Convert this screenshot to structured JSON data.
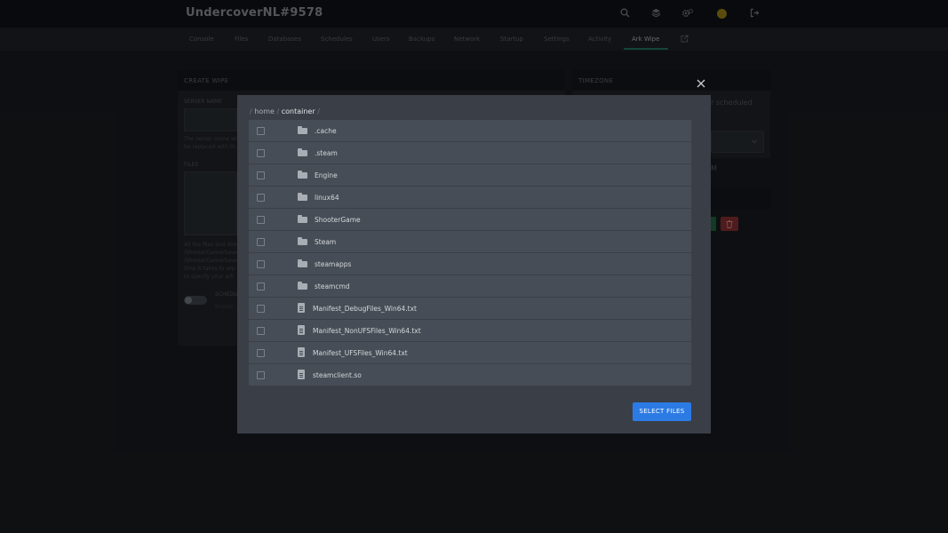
{
  "app": {
    "server_title": "UndercoverNL#9578",
    "icons": [
      "search-icon",
      "layers-icon",
      "settings-icon",
      "avatar",
      "logout-icon"
    ]
  },
  "nav": {
    "tabs": [
      "Console",
      "Files",
      "Databases",
      "Schedules",
      "Users",
      "Backups",
      "Network",
      "Startup",
      "Settings",
      "Activity",
      "Ark Wipe"
    ],
    "active_tab": "Ark Wipe",
    "external_icon": "external-link-icon"
  },
  "background": {
    "create_wipe": {
      "header": "CREATE WIPE",
      "server_name_label": "SERVER NAME",
      "server_name_help": [
        "The server name wi",
        "be replaced with th"
      ],
      "files_label": "FILES",
      "files_help": [
        "All the files and dire",
        "/ShooterGame/Save",
        "/ShooterGame/Save",
        "time it takes to wip",
        "to specify your ark"
      ],
      "schedule_label": "SCHEDU",
      "schedule_sub": "Enable"
    },
    "timezone": {
      "header": "TIMEZONE",
      "text": "r scheduled",
      "text2": "M"
    },
    "colors": {
      "green": "#1f8a4c",
      "red": "#b03a3a"
    }
  },
  "modal": {
    "close_icon": "close-icon",
    "breadcrumb": {
      "root_sep": "/",
      "items": [
        "home",
        "container"
      ],
      "trailing": "/"
    },
    "entries": [
      {
        "name": ".cache",
        "type": "folder"
      },
      {
        "name": ".steam",
        "type": "folder"
      },
      {
        "name": "Engine",
        "type": "folder"
      },
      {
        "name": "linux64",
        "type": "folder"
      },
      {
        "name": "ShooterGame",
        "type": "folder"
      },
      {
        "name": "Steam",
        "type": "folder"
      },
      {
        "name": "steamapps",
        "type": "folder"
      },
      {
        "name": "steamcmd",
        "type": "folder"
      },
      {
        "name": "Manifest_DebugFiles_Win64.txt",
        "type": "file"
      },
      {
        "name": "Manifest_NonUFSFiles_Win64.txt",
        "type": "file"
      },
      {
        "name": "Manifest_UFSFiles_Win64.txt",
        "type": "file"
      },
      {
        "name": "steamclient.so",
        "type": "file"
      }
    ],
    "select_button": "SELECT FILES",
    "accent": "#2c7be5"
  }
}
